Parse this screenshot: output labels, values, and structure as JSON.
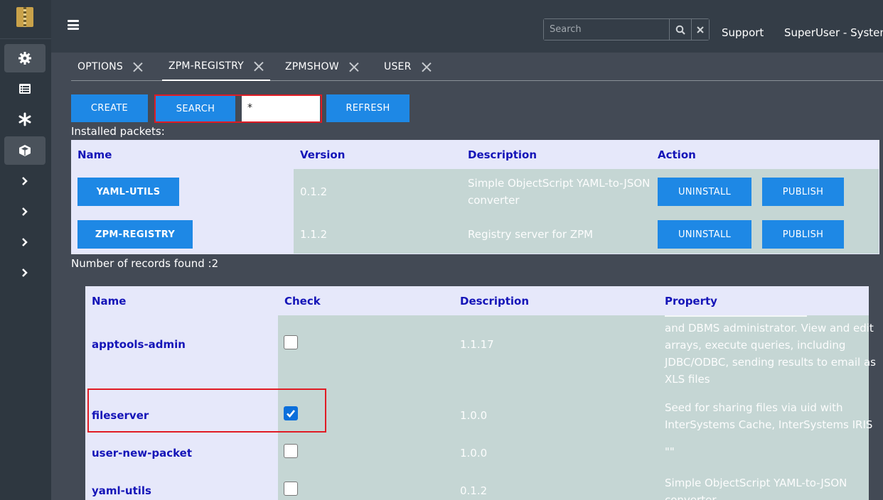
{
  "header": {
    "search_placeholder": "Search",
    "support_label": "Support",
    "user_label": "SuperUser - System"
  },
  "tabs": [
    {
      "label": "OPTIONS"
    },
    {
      "label": "ZPM-REGISTRY"
    },
    {
      "label": "ZPMSHOW"
    },
    {
      "label": "USER"
    }
  ],
  "toolbar": {
    "create_label": "CREATE",
    "search_label": "SEARCH",
    "mask_value": "*",
    "refresh_label": "REFRESH"
  },
  "installed": {
    "title": "Installed packets:",
    "headers": {
      "name": "Name",
      "version": "Version",
      "description": "Description",
      "action": "Action"
    },
    "rows": [
      {
        "name": "YAML-UTILS",
        "version": "0.1.2",
        "description_1": "Simple ObjectScript YAML-to-JSON",
        "description_2": "converter",
        "uninstall": "UNINSTALL",
        "publish": "PUBLISH"
      },
      {
        "name": "ZPM-REGISTRY",
        "version": "1.1.2",
        "description_1": "Registry server for ZPM",
        "uninstall": "UNINSTALL",
        "publish": "PUBLISH"
      }
    ],
    "records_text": "Number of records found :2"
  },
  "registry": {
    "headers": {
      "name": "Name",
      "check": "Check",
      "description": "Description",
      "property": "Property"
    },
    "rows": [
      {
        "name": "apptools-admin",
        "checked": false,
        "version": "1.1.17",
        "prop_1": "and DBMS administrator. View and edit",
        "prop_2": "arrays, execute queries, including",
        "prop_3": "JDBC/ODBC, sending results to email as",
        "prop_4": "XLS files"
      },
      {
        "name": "fileserver",
        "checked": true,
        "version": "1.0.0",
        "prop_1": "Seed for sharing files via uid with",
        "prop_2": "InterSystems Cache, InterSystems IRIS"
      },
      {
        "name": "user-new-packet",
        "checked": false,
        "version": "1.0.0",
        "prop_1": "\"\""
      },
      {
        "name": "yaml-utils",
        "checked": false,
        "version": "0.1.2",
        "prop_1": "Simple ObjectScript YAML-to-JSON",
        "prop_2": "converter"
      }
    ]
  },
  "colors": {
    "accent": "#1e88e5",
    "highlight": "#e01b24",
    "header_text": "#1515b8"
  }
}
